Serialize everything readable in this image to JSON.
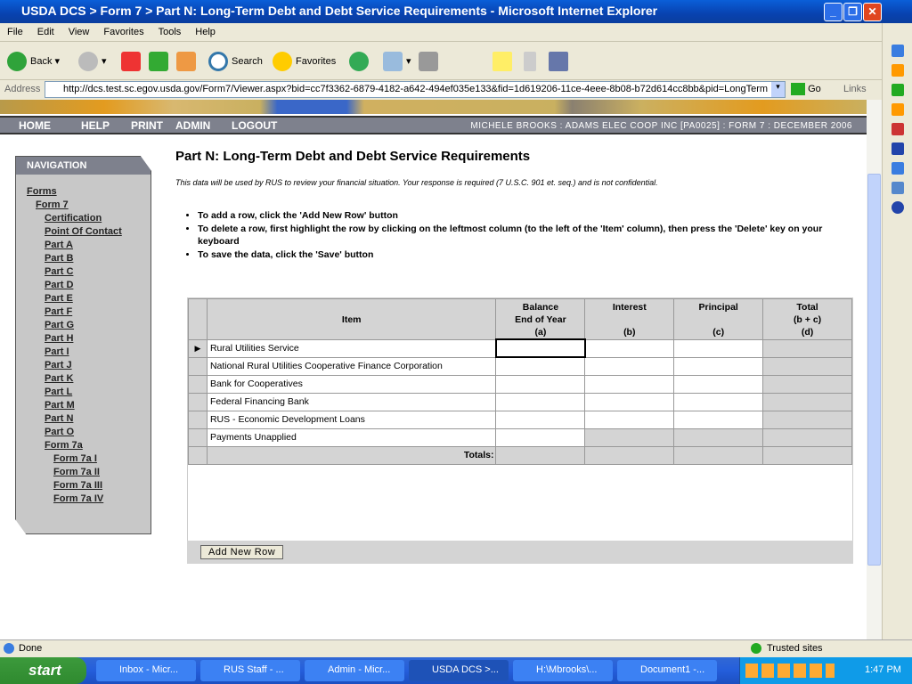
{
  "window": {
    "title": "USDA DCS > Form 7 > Part N: Long-Term Debt and Debt Service Requirements - Microsoft Internet Explorer",
    "min": "_",
    "max": "❐",
    "close": "✕"
  },
  "menu": [
    "File",
    "Edit",
    "View",
    "Favorites",
    "Tools",
    "Help"
  ],
  "toolbar": {
    "back": "Back",
    "search": "Search",
    "favorites": "Favorites"
  },
  "address": {
    "label": "Address",
    "url": "http://dcs.test.sc.egov.usda.gov/Form7/Viewer.aspx?bid=cc7f3362-6879-4182-a642-494ef035e133&fid=1d619206-11ce-4eee-8b08-b72d614cc8bb&pid=LongTerm",
    "go": "Go",
    "links": "Links"
  },
  "topnav": {
    "items": [
      "HOME",
      "HELP",
      "PRINT",
      "ADMIN",
      "LOGOUT"
    ],
    "user": "MICHELE BROOKS : ADAMS ELEC COOP INC [PA0025] : FORM 7 : DECEMBER 2006"
  },
  "navigation": {
    "title": "NAVIGATION",
    "forms": "Forms",
    "form7": "Form 7",
    "parts": [
      "Certification",
      "Point Of Contact",
      "Part A",
      "Part B",
      "Part C",
      "Part D",
      "Part E",
      "Part F",
      "Part G",
      "Part H",
      "Part I",
      "Part J",
      "Part K",
      "Part L",
      "Part M",
      "Part N",
      "Part O",
      "Form 7a"
    ],
    "form7a": [
      "Form 7a I",
      "Form 7a II",
      "Form 7a III",
      "Form 7a IV"
    ]
  },
  "page": {
    "title": "Part N: Long-Term Debt and Debt Service Requirements",
    "disclaimer": "This data will be used by RUS to review your financial situation. Your response is required (7 U.S.C. 901 et. seq.) and is not confidential.",
    "instructions": [
      "To add a row, click the 'Add New Row' button",
      "To delete a row, first highlight the row by clicking on the leftmost column (to the left of the 'Item' column), then press the 'Delete' key on your keyboard",
      "To save the data, click the 'Save' button"
    ]
  },
  "table": {
    "headers": {
      "item": "Item",
      "a": [
        "Balance",
        "End of Year",
        "(a)"
      ],
      "b": [
        "Interest",
        "",
        "(b)"
      ],
      "c": [
        "Principal",
        "",
        "(c)"
      ],
      "d": [
        "Total",
        "(b + c)",
        "(d)"
      ]
    },
    "rows": [
      "Rural Utilities Service",
      "National Rural Utilities Cooperative Finance Corporation",
      "Bank for Cooperatives",
      "Federal Financing Bank",
      "RUS - Economic Development Loans",
      "Payments Unapplied"
    ],
    "totals_label": "Totals:",
    "add_row": "Add New Row"
  },
  "status": {
    "text": "Done",
    "zone": "Trusted sites"
  },
  "taskbar": {
    "start": "start",
    "tasks": [
      "Inbox - Micr...",
      "RUS Staff - ...",
      "Admin - Micr...",
      "USDA DCS >...",
      "H:\\Mbrooks\\...",
      "Document1 -..."
    ],
    "clock": "1:47 PM"
  }
}
